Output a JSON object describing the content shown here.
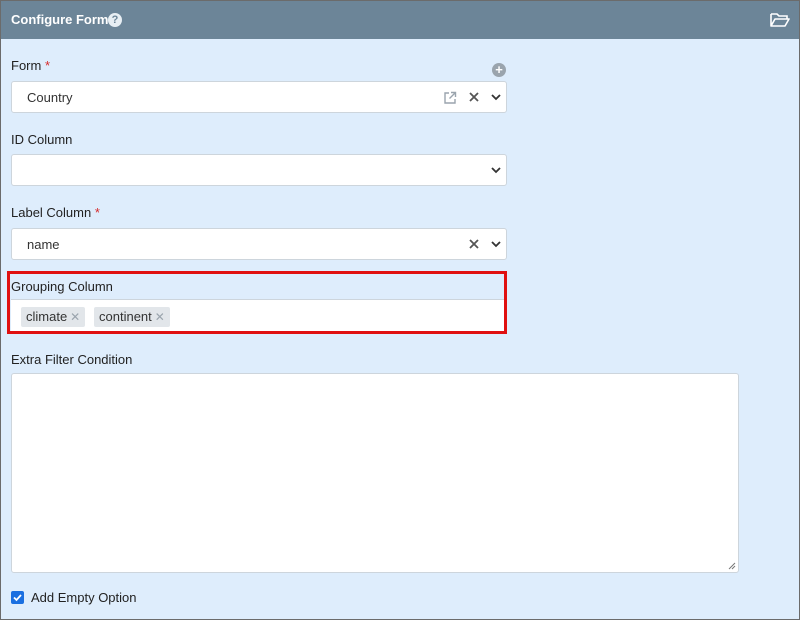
{
  "header": {
    "title": "Configure Form",
    "help_icon": "question-circle-icon",
    "folder_icon": "folder-open-icon"
  },
  "form": {
    "label": "Form",
    "required_mark": "*",
    "value": "Country"
  },
  "id_column": {
    "label": "ID Column",
    "value": ""
  },
  "label_column": {
    "label": "Label Column",
    "required_mark": "*",
    "value": "name"
  },
  "grouping_column": {
    "label": "Grouping Column",
    "tags": [
      "climate",
      "continent"
    ]
  },
  "extra_filter": {
    "label": "Extra Filter Condition",
    "value": ""
  },
  "add_empty": {
    "label": "Add Empty Option",
    "checked": true
  },
  "colors": {
    "header_bg": "#6c8598",
    "panel_bg": "#deedfc",
    "highlight": "#e01010",
    "checkbox": "#1a6fe0"
  }
}
